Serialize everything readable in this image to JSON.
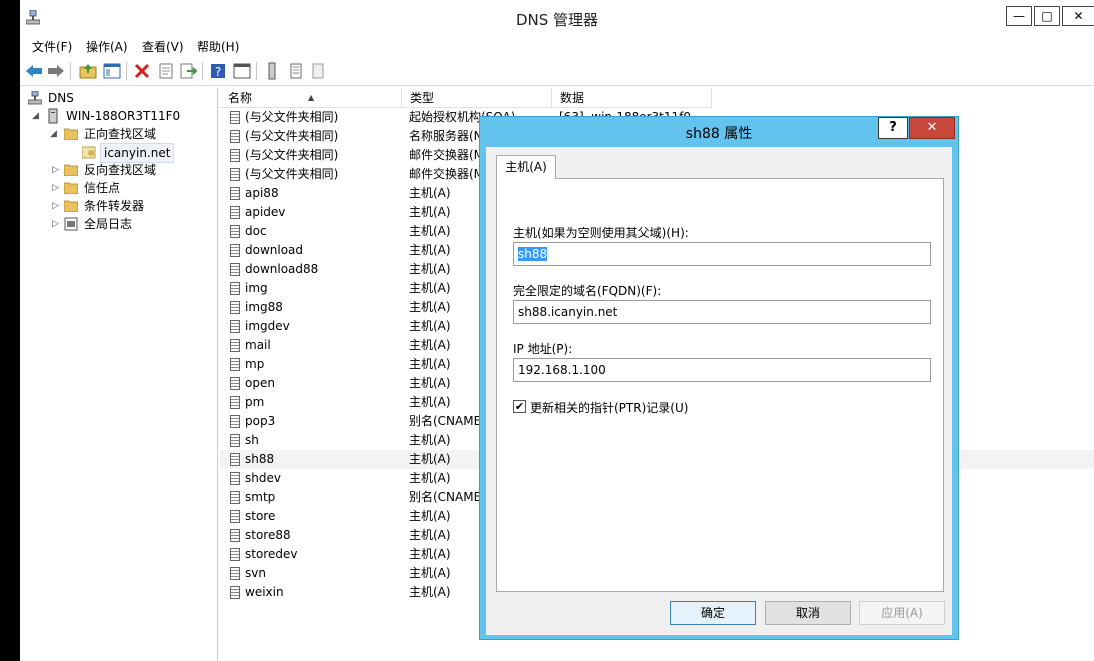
{
  "window": {
    "title": "DNS 管理器",
    "controls": {
      "minimize": "—",
      "maximize": "□",
      "close": "✕"
    }
  },
  "menu": {
    "items": [
      "文件(F)",
      "操作(A)",
      "查看(V)",
      "帮助(H)"
    ]
  },
  "toolbar": {
    "icons": [
      "back-icon",
      "forward-icon",
      "up-folder-icon",
      "show-tree-icon",
      "delete-icon",
      "properties-icon",
      "export-icon",
      "help-icon",
      "console-icon",
      "server-icon",
      "list-icon",
      "refresh-icon"
    ]
  },
  "tree": {
    "root": "DNS",
    "server": "WIN-188OR3T11F0",
    "forward_zones": "正向查找区域",
    "zone": "icanyin.net",
    "reverse_zones": "反向查找区域",
    "trust_points": "信任点",
    "conditional_forwarders": "条件转发器",
    "global_logs": "全局日志"
  },
  "list": {
    "columns": [
      "名称",
      "类型",
      "数据"
    ],
    "rows": [
      {
        "name": "(与父文件夹相同)",
        "type": "起始授权机构(SOA)",
        "data": "[63], win-188or3t11f0"
      },
      {
        "name": "(与父文件夹相同)",
        "type": "名称服务器(NS)",
        "data": ""
      },
      {
        "name": "(与父文件夹相同)",
        "type": "邮件交换器(MX)",
        "data": ""
      },
      {
        "name": "(与父文件夹相同)",
        "type": "邮件交换器(MX)",
        "data": ""
      },
      {
        "name": "api88",
        "type": "主机(A)",
        "data": ""
      },
      {
        "name": "apidev",
        "type": "主机(A)",
        "data": ""
      },
      {
        "name": "doc",
        "type": "主机(A)",
        "data": ""
      },
      {
        "name": "download",
        "type": "主机(A)",
        "data": ""
      },
      {
        "name": "download88",
        "type": "主机(A)",
        "data": ""
      },
      {
        "name": "img",
        "type": "主机(A)",
        "data": ""
      },
      {
        "name": "img88",
        "type": "主机(A)",
        "data": ""
      },
      {
        "name": "imgdev",
        "type": "主机(A)",
        "data": ""
      },
      {
        "name": "mail",
        "type": "主机(A)",
        "data": ""
      },
      {
        "name": "mp",
        "type": "主机(A)",
        "data": ""
      },
      {
        "name": "open",
        "type": "主机(A)",
        "data": ""
      },
      {
        "name": "pm",
        "type": "主机(A)",
        "data": ""
      },
      {
        "name": "pop3",
        "type": "别名(CNAME)",
        "data": ""
      },
      {
        "name": "sh",
        "type": "主机(A)",
        "data": ""
      },
      {
        "name": "sh88",
        "type": "主机(A)",
        "data": ""
      },
      {
        "name": "shdev",
        "type": "主机(A)",
        "data": ""
      },
      {
        "name": "smtp",
        "type": "别名(CNAME)",
        "data": ""
      },
      {
        "name": "store",
        "type": "主机(A)",
        "data": ""
      },
      {
        "name": "store88",
        "type": "主机(A)",
        "data": ""
      },
      {
        "name": "storedev",
        "type": "主机(A)",
        "data": ""
      },
      {
        "name": "svn",
        "type": "主机(A)",
        "data": ""
      },
      {
        "name": "weixin",
        "type": "主机(A)",
        "data": ""
      }
    ],
    "selected_index": 18
  },
  "dialog": {
    "title": "sh88 属性",
    "help": "?",
    "close": "✕",
    "tab": "主机(A)",
    "host_label": "主机(如果为空则使用其父域)(H):",
    "host_value": "sh88",
    "fqdn_label": "完全限定的域名(FQDN)(F):",
    "fqdn_value": "sh88.icanyin.net",
    "ip_label": "IP 地址(P):",
    "ip_value": "192.168.1.100",
    "ptr_label": "更新相关的指针(PTR)记录(U)",
    "ptr_checked": true,
    "ok": "确定",
    "cancel": "取消",
    "apply": "应用(A)"
  },
  "colors": {
    "dialog_frame": "#62c3ee",
    "close_button": "#c7483b",
    "selection": "#3399ff"
  }
}
